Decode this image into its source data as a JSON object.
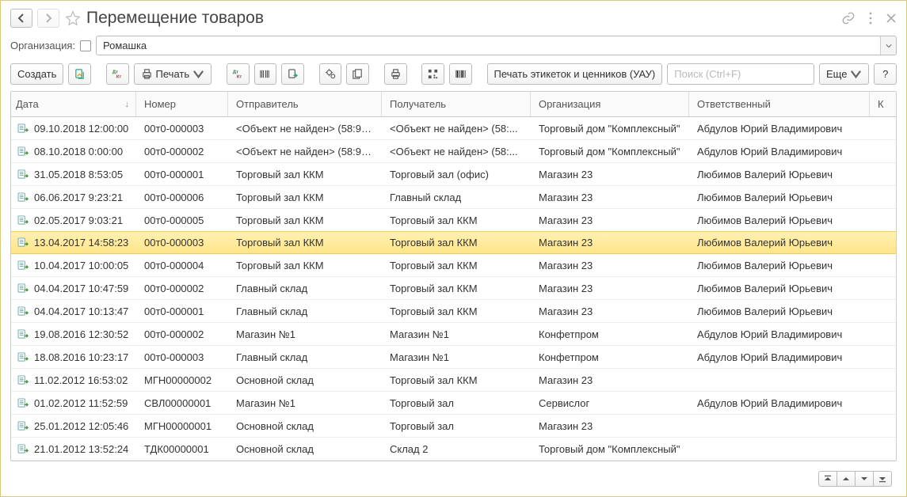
{
  "header": {
    "title": "Перемещение товаров"
  },
  "org": {
    "label": "Организация:",
    "value": "Ромашка"
  },
  "toolbar": {
    "create": "Создать",
    "print": "Печать",
    "print_labels": "Печать этикеток и ценников (УАУ)",
    "more": "Еще",
    "help": "?"
  },
  "search": {
    "placeholder": "Поиск (Ctrl+F)"
  },
  "columns": {
    "date": "Дата",
    "number": "Номер",
    "sender": "Отправитель",
    "receiver": "Получатель",
    "org": "Организация",
    "responsible": "Ответственный",
    "extra": "К"
  },
  "rows": [
    {
      "date": "09.10.2018 12:00:00",
      "number": "00т0-000003",
      "sender": "<Объект не найден> (58:96...",
      "receiver": "<Объект не найден> (58:...",
      "org": "Торговый дом \"Комплексный\"",
      "responsible": "Абдулов Юрий Владимирович",
      "selected": false
    },
    {
      "date": "08.10.2018 0:00:00",
      "number": "00т0-000002",
      "sender": "<Объект не найден> (58:96...",
      "receiver": "<Объект не найден> (58:...",
      "org": "Торговый дом \"Комплексный\"",
      "responsible": "Абдулов Юрий Владимирович",
      "selected": false
    },
    {
      "date": "31.05.2018 8:53:05",
      "number": "00т0-000001",
      "sender": "Торговый зал ККМ",
      "receiver": "Торговый зал (офис)",
      "org": "Магазин 23",
      "responsible": "Любимов Валерий Юрьевич",
      "selected": false
    },
    {
      "date": "06.06.2017 9:23:21",
      "number": "00т0-000006",
      "sender": "Торговый зал ККМ",
      "receiver": "Главный склад",
      "org": "Магазин 23",
      "responsible": "Любимов Валерий Юрьевич",
      "selected": false
    },
    {
      "date": "02.05.2017 9:03:21",
      "number": "00т0-000005",
      "sender": "Торговый зал ККМ",
      "receiver": "Торговый зал ККМ",
      "org": "Магазин 23",
      "responsible": "Любимов Валерий Юрьевич",
      "selected": false
    },
    {
      "date": "13.04.2017 14:58:23",
      "number": "00т0-000003",
      "sender": "Торговый зал ККМ",
      "receiver": "Торговый зал ККМ",
      "org": "Магазин 23",
      "responsible": "Любимов Валерий Юрьевич",
      "selected": true
    },
    {
      "date": "10.04.2017 10:00:05",
      "number": "00т0-000004",
      "sender": "Торговый зал ККМ",
      "receiver": "Торговый зал ККМ",
      "org": "Магазин 23",
      "responsible": "Любимов Валерий Юрьевич",
      "selected": false
    },
    {
      "date": "04.04.2017 10:47:59",
      "number": "00т0-000002",
      "sender": "Главный склад",
      "receiver": "Торговый зал ККМ",
      "org": "Магазин 23",
      "responsible": "Любимов Валерий Юрьевич",
      "selected": false
    },
    {
      "date": "04.04.2017 10:13:47",
      "number": "00т0-000001",
      "sender": "Главный склад",
      "receiver": "Торговый зал ККМ",
      "org": "Магазин 23",
      "responsible": "Любимов Валерий Юрьевич",
      "selected": false
    },
    {
      "date": "19.08.2016 12:30:52",
      "number": "00т0-000002",
      "sender": "Магазин №1",
      "receiver": "Магазин №1",
      "org": "Конфетпром",
      "responsible": "Абдулов Юрий Владимирович",
      "selected": false
    },
    {
      "date": "18.08.2016 10:23:17",
      "number": "00т0-000003",
      "sender": "Главный склад",
      "receiver": "Магазин №1",
      "org": "Конфетпром",
      "responsible": "Абдулов Юрий Владимирович",
      "selected": false
    },
    {
      "date": "11.02.2012 16:53:02",
      "number": "МГН00000002",
      "sender": "Основной склад",
      "receiver": "Торговый зал ККМ",
      "org": "Магазин 23",
      "responsible": "",
      "selected": false
    },
    {
      "date": "01.02.2012 11:52:59",
      "number": "СВЛ00000001",
      "sender": "Магазин №1",
      "receiver": "Торговый зал",
      "org": "Сервислог",
      "responsible": "Абдулов Юрий Владимирович",
      "selected": false
    },
    {
      "date": "25.01.2012 12:05:46",
      "number": "МГН00000001",
      "sender": "Основной склад",
      "receiver": "Торговый зал",
      "org": "Магазин 23",
      "responsible": "",
      "selected": false
    },
    {
      "date": "21.01.2012 13:52:24",
      "number": "ТДК00000001",
      "sender": "Основной склад",
      "receiver": "Склад 2",
      "org": "Торговый дом \"Комплексный\"",
      "responsible": "",
      "selected": false
    }
  ]
}
